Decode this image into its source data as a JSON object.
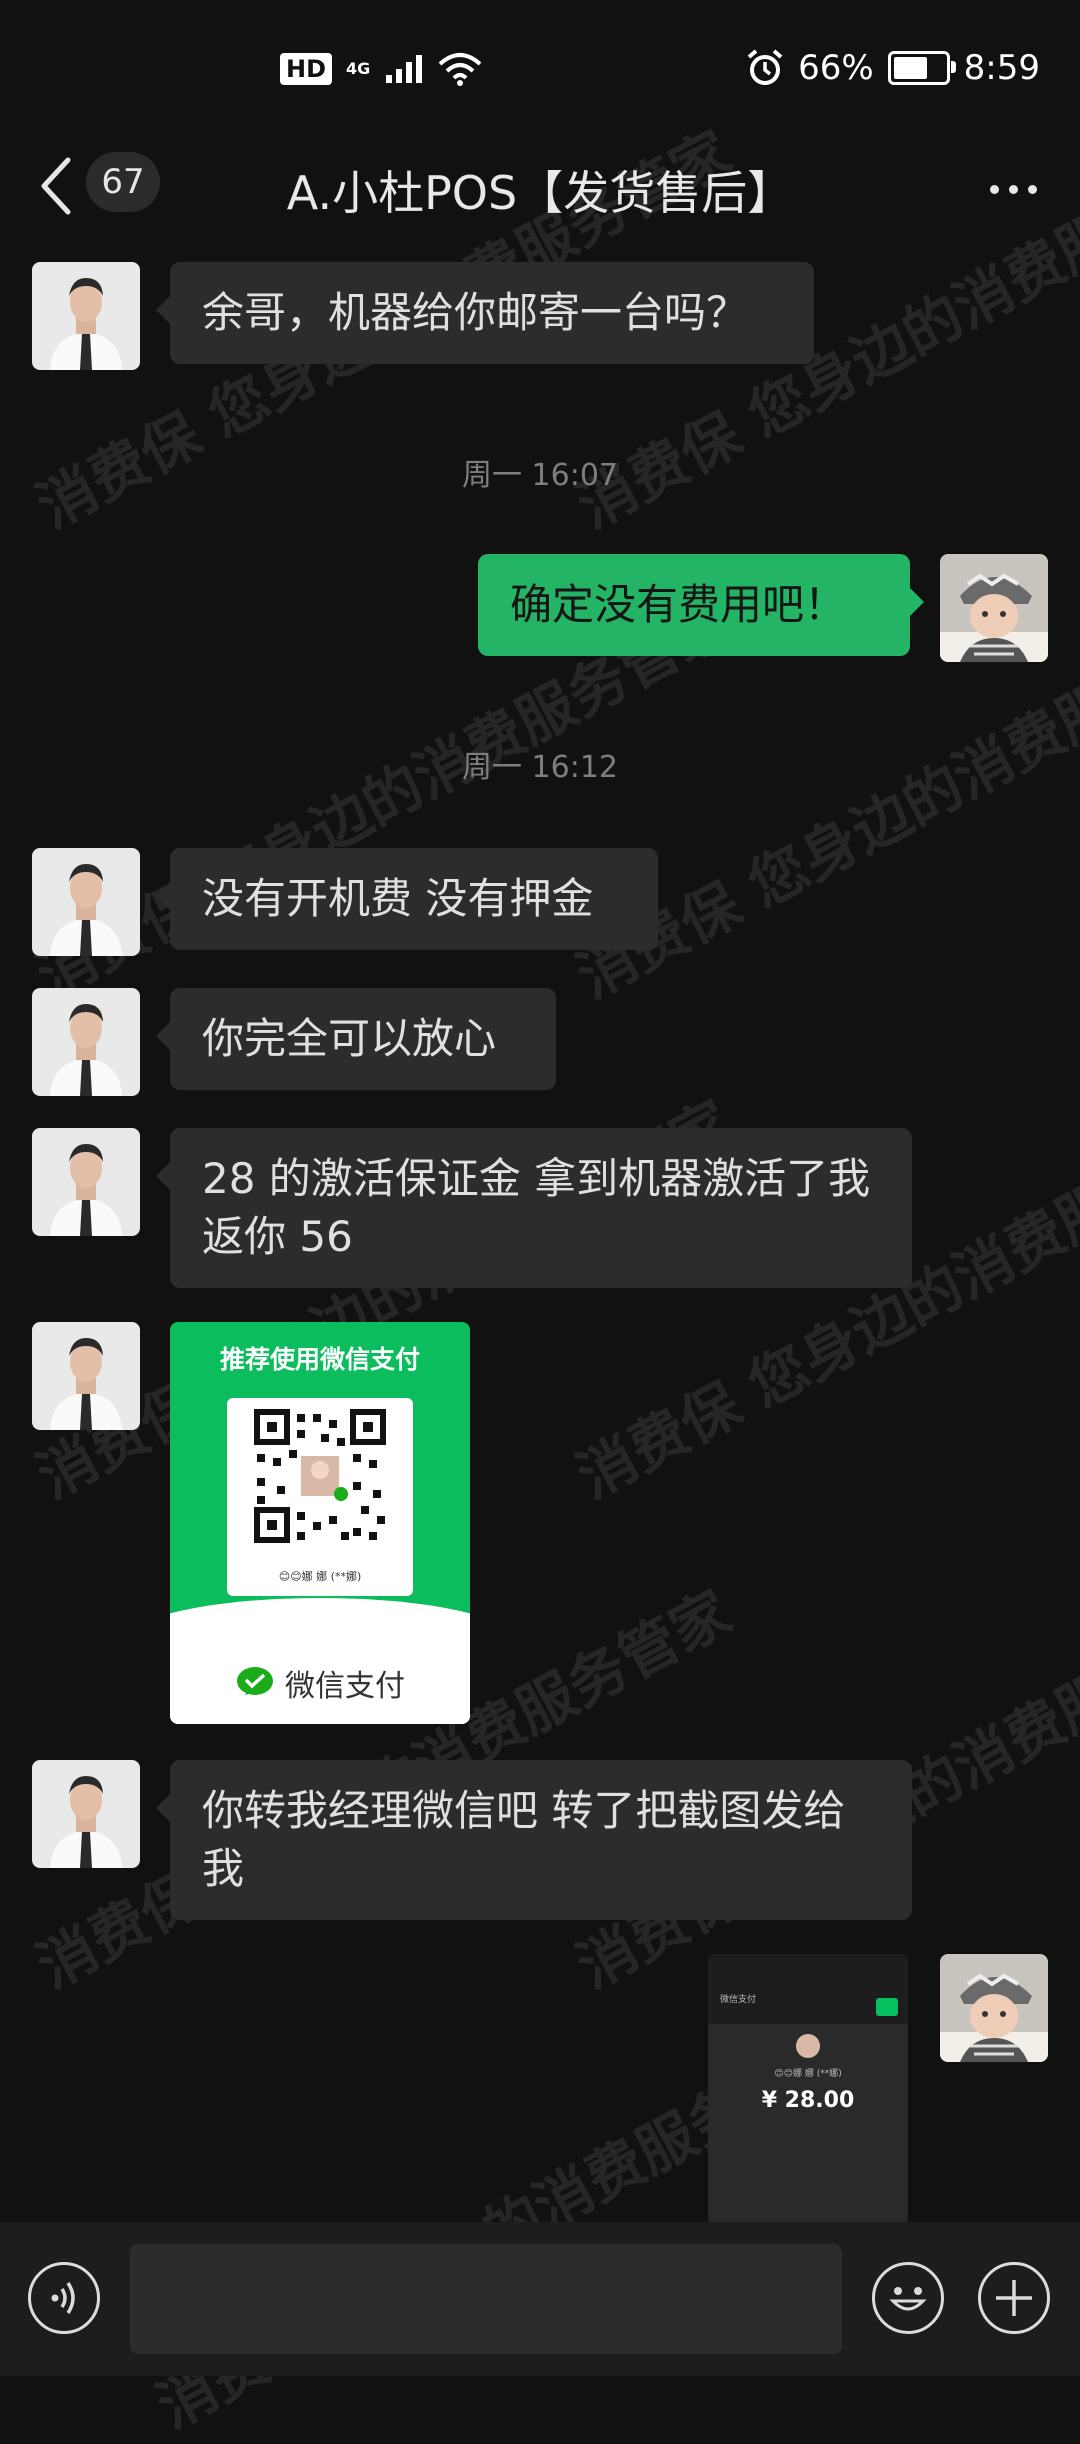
{
  "status_bar": {
    "hd": "HD",
    "network": "4G",
    "battery_percent": "66%",
    "battery_level": 0.66,
    "time": "8:59"
  },
  "nav": {
    "unread_count": "67",
    "title": "A.小杜POS【发货售后】"
  },
  "messages": [
    {
      "side": "left",
      "type": "text",
      "text": "余哥，机器给你邮寄一台吗？"
    },
    {
      "type": "time",
      "text": "周一 16:07"
    },
    {
      "side": "right",
      "type": "text",
      "text": "确定没有费用吧！"
    },
    {
      "type": "time",
      "text": "周一 16:12"
    },
    {
      "side": "left",
      "type": "text",
      "text": "没有开机费 没有押金"
    },
    {
      "side": "left",
      "type": "text",
      "text": "你完全可以放心"
    },
    {
      "side": "left",
      "type": "text",
      "text": "28 的激活保证金 拿到机器激活了我返你 56"
    },
    {
      "side": "left",
      "type": "image",
      "header": "推荐使用微信支付",
      "name": "😊😊娜 娜 (**娜)",
      "footer": "微信支付"
    },
    {
      "side": "left",
      "type": "text",
      "text": "你转我经理微信吧 转了把截图发给我"
    },
    {
      "side": "right",
      "type": "image",
      "top_line": "微信支付",
      "name": "😊😊娜 娜 (**娜)",
      "amount": "¥ 28.00"
    }
  ],
  "watermark": "消费保 您身边的消费服务管家",
  "colors": {
    "background": "#111111",
    "bubble_left": "#2c2c2c",
    "bubble_right": "#23b565",
    "wechat_green": "#0bbd5c"
  }
}
